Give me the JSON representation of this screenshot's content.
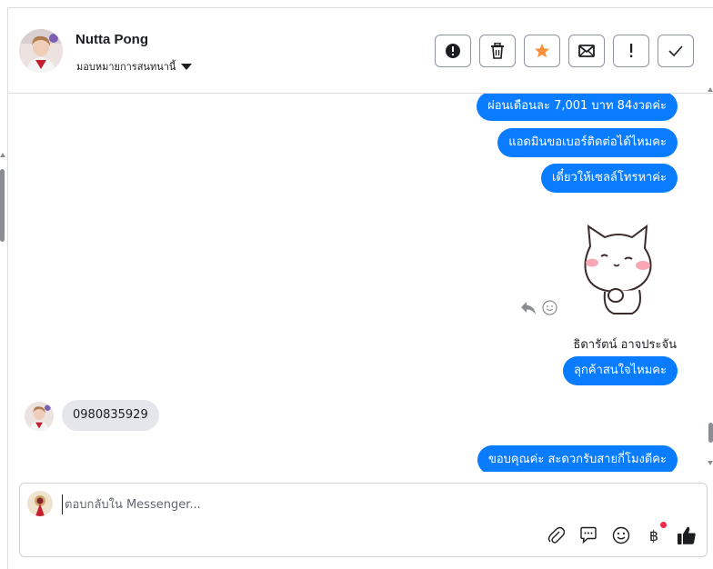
{
  "header": {
    "contact_name": "Nutta Pong",
    "assign_label": "มอบหมายการสนทนานี้",
    "toolbar": [
      {
        "name": "spam-button",
        "icon": "exclamation-circle-icon"
      },
      {
        "name": "delete-button",
        "icon": "trash-icon"
      },
      {
        "name": "star-button",
        "icon": "star-icon",
        "color": "#f7923a"
      },
      {
        "name": "mark-unread-button",
        "icon": "envelope-icon"
      },
      {
        "name": "follow-up-button",
        "icon": "exclamation-icon"
      },
      {
        "name": "mark-done-button",
        "icon": "checkmark-icon"
      }
    ]
  },
  "conversation": {
    "messages_out_top": [
      "ผ่อนเดือนละ 7,001 บาท 84งวดค่ะ",
      "แอดมินขอเบอร์ติดต่อได้ไหมคะ",
      "เดี๋ยวให้เซลล์โทรหาค่ะ"
    ],
    "sender_name": "ธิดารัตน์ อาจประจัน",
    "message_out_mid": "ลุกค้าสนใจไหมคะ",
    "message_in": "0980835929",
    "message_out_bottom": "ขอบคุณค่ะ สะดวกรับสายกี่โมงดีคะ"
  },
  "composer": {
    "placeholder": "ตอบกลับใน Messenger...",
    "currency_symbol": "฿",
    "icons": [
      "paperclip-icon",
      "chat-bubble-icon",
      "emoji-icon",
      "baht-icon",
      "thumbs-up-icon"
    ]
  },
  "colors": {
    "accent": "#0a7cff",
    "incoming_bubble": "#e4e6eb",
    "star": "#f7923a",
    "notification_dot": "#f02849"
  }
}
